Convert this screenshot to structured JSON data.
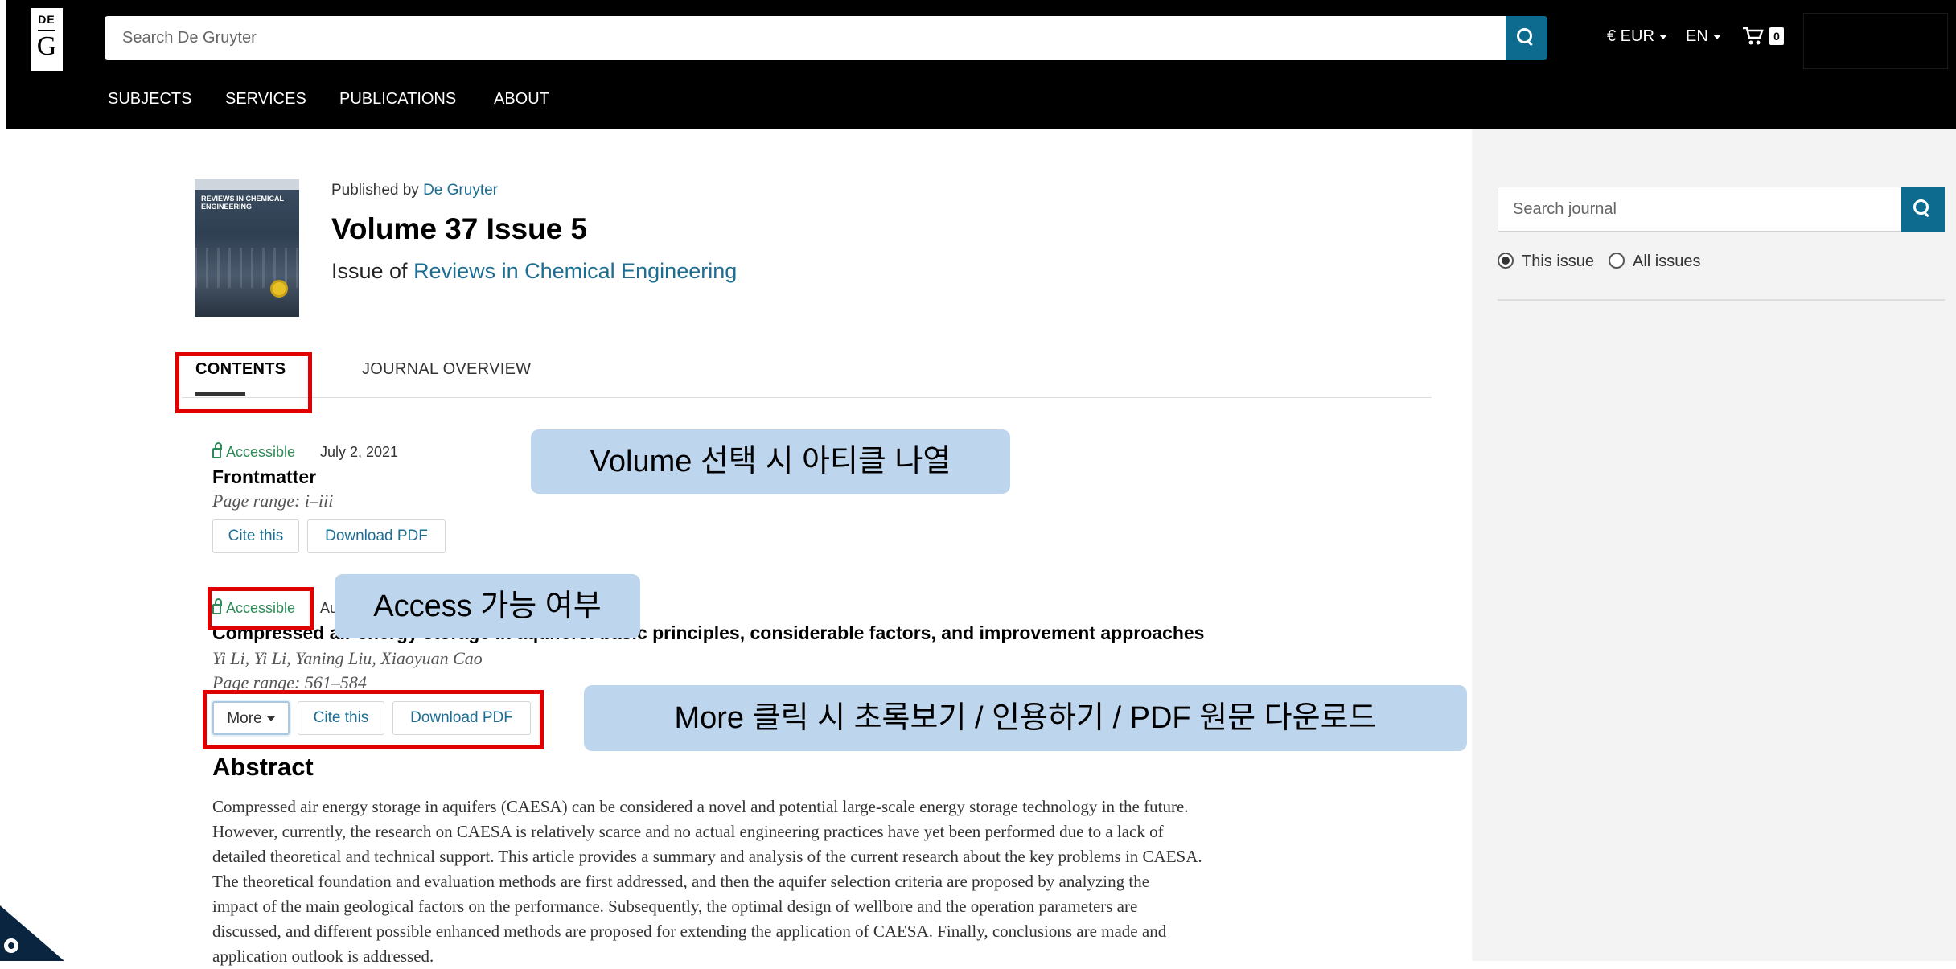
{
  "header": {
    "logo_top": "DE",
    "logo_bottom": "G",
    "search_placeholder": "Search De Gruyter",
    "currency": "€ EUR",
    "language": "EN",
    "cart_count": "0",
    "nav": [
      "SUBJECTS",
      "SERVICES",
      "PUBLICATIONS",
      "ABOUT"
    ]
  },
  "issue": {
    "published_prefix": "Published by ",
    "publisher": "De Gruyter",
    "title": "Volume 37 Issue 5",
    "issue_of_prefix": "Issue of ",
    "journal": "Reviews in Chemical Engineering",
    "cover_text": "REVIEWS IN CHEMICAL ENGINEERING"
  },
  "tabs": [
    "CONTENTS",
    "JOURNAL OVERVIEW"
  ],
  "articles": [
    {
      "access": "Accessible",
      "date": "July 2, 2021",
      "title": "Frontmatter",
      "pages": "Page range: i–iii",
      "buttons": [
        "Cite this",
        "Download PDF"
      ]
    },
    {
      "access": "Accessible",
      "date": "Au",
      "title_visible": "Compressed air energy storage in aquifers: basic principles, considerable factors, and improvement approaches",
      "authors": "Yi Li, Yi Li, Yaning Liu, Xiaoyuan Cao",
      "pages": "Page range: 561–584",
      "buttons": [
        "More",
        "Cite this",
        "Download PDF"
      ]
    }
  ],
  "abstract": {
    "heading": "Abstract",
    "lines": [
      "Compressed air energy storage in aquifers (CAESA) can be considered a novel and potential large-scale energy storage technology in the future.",
      "However, currently, the research on CAESA is relatively scarce and no actual engineering practices have yet been performed due to a lack of",
      "detailed theoretical and technical support. This article provides a summary and analysis of the current research about the key problems in CAESA.",
      "The theoretical foundation and evaluation methods are first addressed, and then the aquifer selection criteria are proposed by analyzing the",
      "impact of the main geological factors on the performance. Subsequently, the optimal design of wellbore and the operation parameters are",
      "discussed, and different possible enhanced methods are proposed for extending the application of CAESA. Finally, conclusions are made and",
      "application outlook is addressed."
    ]
  },
  "sidebar": {
    "search_placeholder": "Search journal",
    "radio_this": "This issue",
    "radio_all": "All issues"
  },
  "annotations": {
    "volume_note": "Volume 선택 시 아티클 나열",
    "access_note": "Access 가능 여부",
    "more_note": "More 클릭 시 초록보기 / 인용하기 / PDF 원문 다운로드"
  },
  "colors": {
    "header_bg": "#000000",
    "accent": "#0c6b8f",
    "link": "#1d6e93",
    "accessible": "#2e8b57",
    "annotation_bg": "#bdd6ee",
    "annotation_border": "#e00000",
    "sidebar_bg": "#f3f3f3"
  }
}
